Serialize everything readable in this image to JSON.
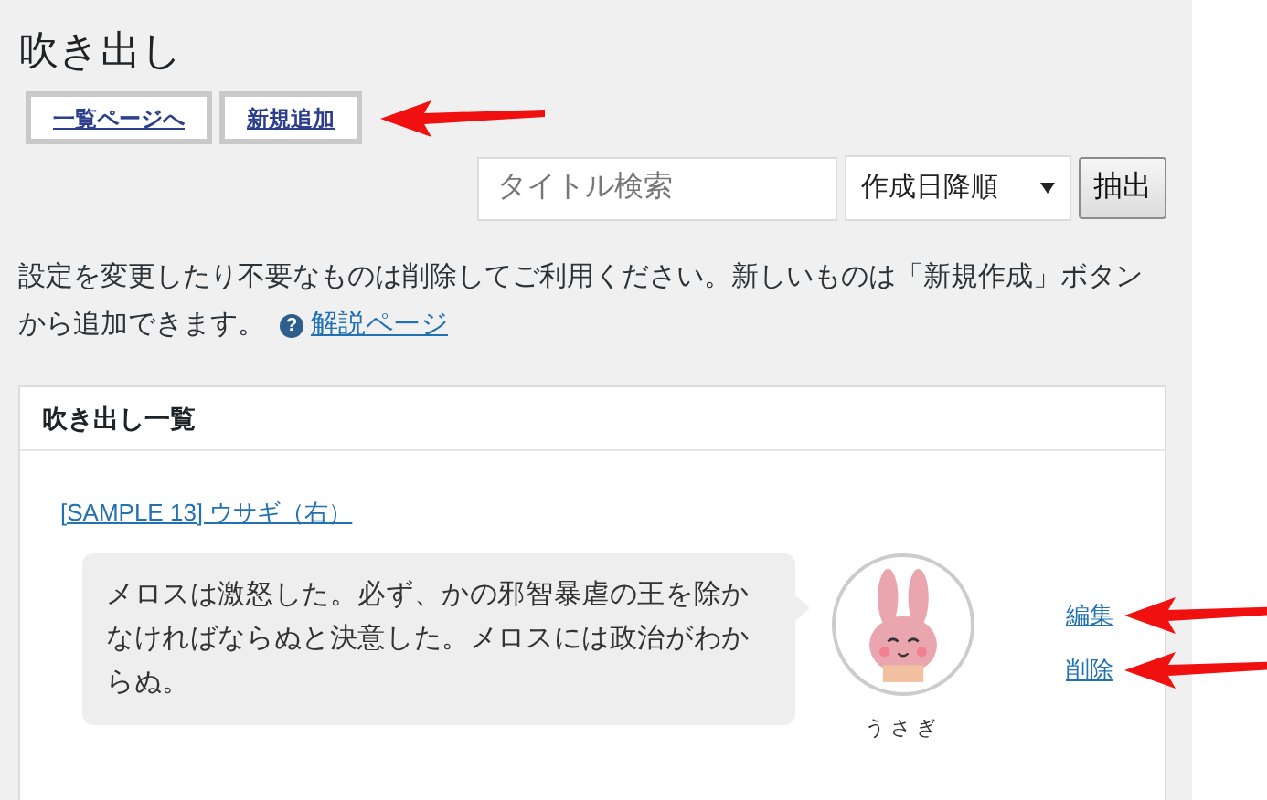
{
  "page_title": "吹き出し",
  "nav_buttons": [
    "一覧ページへ",
    "新規追加"
  ],
  "filter": {
    "search": {
      "placeholder": "タイトル検索"
    },
    "sort": {
      "value": "作成日降順"
    },
    "submit": "抽出"
  },
  "notice": {
    "text": "設定を変更したり不要なものは削除してご利用ください。新しいものは「新規作成」ボタンから追加できます。",
    "help_icon": "?",
    "link": "解説ページ"
  },
  "list": {
    "title": "吹き出し一覧",
    "items": [
      {
        "title": "[SAMPLE 13] ウサギ（右）",
        "text": "メロスは激怒した。必ず、かの邪智暴虐の王を除かなければならぬと決意した。メロスには政治がわからぬ。",
        "avatar_name": "うさぎ",
        "actions": [
          "編集",
          "削除"
        ]
      }
    ]
  }
}
